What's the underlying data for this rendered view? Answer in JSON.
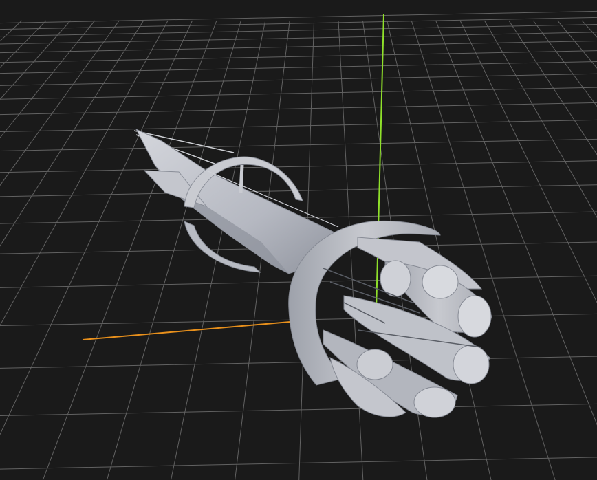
{
  "viewport": {
    "background_color": "#1a1a1a",
    "grid_color": "#6a6a6a",
    "x_axis_color": "#e8901c",
    "y_axis_color": "#8fe02a",
    "model_color": "#b9bcc6",
    "model_shadow_color": "#7e828d",
    "model_highlight_color": "#d6d8de"
  },
  "model": {
    "description": "spaceship-model",
    "shading": "solid-gray"
  }
}
